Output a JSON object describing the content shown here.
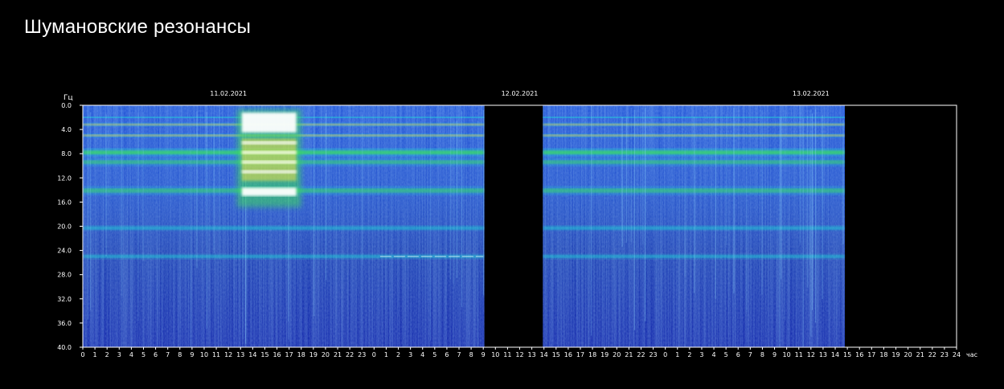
{
  "page": {
    "title": "Шумановские резонансы"
  },
  "chart_data": {
    "type": "heatmap",
    "title": "Шумановские резонансы",
    "ylabel": "Гц",
    "xlabel": "час",
    "ylim": [
      0,
      40
    ],
    "y_reversed": true,
    "y_ticks": [
      "0.0",
      "4.0",
      "8.0",
      "12.0",
      "16.0",
      "20.0",
      "24.0",
      "28.0",
      "32.0",
      "36.0",
      "40.0"
    ],
    "x_range_hours": [
      0,
      72
    ],
    "x_ticks": [
      "0",
      "1",
      "2",
      "3",
      "4",
      "5",
      "6",
      "7",
      "8",
      "9",
      "10",
      "11",
      "12",
      "13",
      "14",
      "15",
      "16",
      "17",
      "18",
      "19",
      "20",
      "21",
      "22",
      "23",
      "0",
      "1",
      "2",
      "3",
      "4",
      "5",
      "6",
      "7",
      "8",
      "9",
      "10",
      "11",
      "12",
      "13",
      "14",
      "15",
      "16",
      "17",
      "18",
      "19",
      "20",
      "21",
      "22",
      "23",
      "0",
      "1",
      "2",
      "3",
      "4",
      "5",
      "6",
      "7",
      "8",
      "9",
      "10",
      "11",
      "12",
      "13",
      "14",
      "15",
      "16",
      "17",
      "18",
      "19",
      "20",
      "21",
      "22",
      "23",
      "24"
    ],
    "dates": [
      {
        "label": "11.02.2021",
        "hour": 12
      },
      {
        "label": "12.02.2021",
        "hour": 36
      },
      {
        "label": "13.02.2021",
        "hour": 60
      }
    ],
    "data_segments_hours": [
      [
        0,
        33.1
      ],
      [
        37.9,
        62.8
      ]
    ],
    "resonance_bands_hz": [
      3.2,
      5.0,
      7.8,
      9.4,
      14.1,
      20.3,
      25.0
    ],
    "intense_burst": {
      "from_hour": 13.1,
      "to_hour": 17.6,
      "from_hz": 1.2,
      "to_hz": 15.5
    },
    "grid": false,
    "colors": {
      "background": "#000000",
      "low": "#0a1fa8",
      "mid": "#1e88e5",
      "cyan": "#22d3d8",
      "green": "#3ddc5a",
      "yellow": "#f2e14a",
      "high": "#ffffff",
      "axis": "#ffffff"
    }
  }
}
